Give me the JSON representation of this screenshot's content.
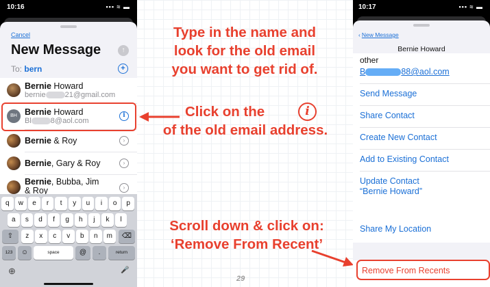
{
  "left_phone": {
    "time": "10:16",
    "status_icons": "▪▪▪ ≈ ▬",
    "cancel": "Cancel",
    "title": "New Message",
    "to_label": "To:",
    "to_value": "bern",
    "contacts": [
      {
        "name_bold": "Bernie",
        "name_rest": " Howard",
        "email_pre": "bernie",
        "email_post": "21@gmail.com",
        "avatar": "photo",
        "action": "none"
      },
      {
        "name_bold": "Bernie",
        "name_rest": " Howard",
        "email_pre": "Bl",
        "email_post": "8@aol.com",
        "avatar": "initials",
        "initials": "BH",
        "action": "info"
      },
      {
        "name_bold": "Bernie",
        "name_rest": " & Roy",
        "avatar": "pair",
        "action": "chevron"
      },
      {
        "name_bold": "Bernie",
        "name_rest": ", Gary & Roy",
        "avatar": "pair",
        "action": "chevron"
      },
      {
        "name_bold": "Bernie",
        "name_rest": ", Bubba, Jim",
        "name_line2": "& Roy",
        "avatar": "pair",
        "action": "chevron"
      }
    ],
    "keyboard": {
      "row1": [
        "q",
        "w",
        "e",
        "r",
        "t",
        "y",
        "u",
        "i",
        "o",
        "p"
      ],
      "row2": [
        "a",
        "s",
        "d",
        "f",
        "g",
        "h",
        "j",
        "k",
        "l"
      ],
      "row3": [
        "z",
        "x",
        "c",
        "v",
        "b",
        "n",
        "m"
      ],
      "shift": "⇧",
      "delete": "⌫",
      "numbers": "123",
      "emoji": "☺",
      "space": "space",
      "at": "@",
      "dot": ".",
      "return": "return",
      "globe": "⊕",
      "mic": "🎤"
    }
  },
  "instructions": {
    "step1_line1": "Type in the name and",
    "step1_line2": "look for the old email",
    "step1_line3": "you want to get rid of.",
    "step2_line1": "Click on the",
    "step2_icon": "i",
    "step2_line2": "of the old email address.",
    "step3_line1": "Scroll down & click on:",
    "step3_line2": "‘Remove From Recent’",
    "page_number": "29"
  },
  "right_phone": {
    "time": "10:17",
    "status_icons": "▪▪▪ ≈ ▬",
    "back": "New Message",
    "contact_name": "Bernie Howard",
    "email_label": "other",
    "email_pre": "B",
    "email_post": "88@aol.com",
    "actions": [
      "Send Message",
      "Share Contact",
      "Create New Contact",
      "Add to Existing Contact"
    ],
    "update_line1": "Update Contact",
    "update_line2": "“Bernie Howard”",
    "share_location": "Share My Location",
    "remove": "Remove From Recents"
  },
  "colors": {
    "accent_red": "#e8402e",
    "ios_blue": "#1a6fd6",
    "ios_background": "#f2f2f7"
  }
}
